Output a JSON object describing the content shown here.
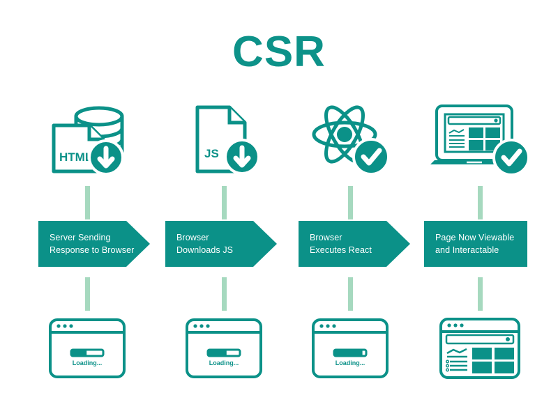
{
  "page": {
    "title": "CSR",
    "background_color": "#ffffff",
    "accent_color": "#0b9188",
    "dash_color": "#a6d9bf",
    "banner_text_color": "#ffffff"
  },
  "steps": [
    {
      "id": "step-1",
      "icon_name": "html-document-database-download-icon",
      "icon_label": "HTML",
      "banner_label": "Server Sending\nResponse to Browser",
      "banner_shape": "arrow",
      "browser_name": "browser-loading-window",
      "browser_status": "Loading...",
      "progress_percent": 45
    },
    {
      "id": "step-2",
      "icon_name": "js-document-download-icon",
      "icon_label": "JS",
      "banner_label": "Browser\nDownloads JS",
      "banner_shape": "arrow",
      "browser_name": "browser-loading-window",
      "browser_status": "Loading...",
      "progress_percent": 55
    },
    {
      "id": "step-3",
      "icon_name": "react-atom-check-icon",
      "icon_label": "",
      "banner_label": "Browser\nExecutes React",
      "banner_shape": "arrow",
      "browser_name": "browser-loading-window",
      "browser_status": "Loading...",
      "progress_percent": 85
    },
    {
      "id": "step-4",
      "icon_name": "laptop-rendered-page-check-icon",
      "icon_label": "",
      "banner_label": "Page Now Viewable\nand Interactable",
      "banner_shape": "rectangle",
      "browser_name": "browser-rendered-window",
      "browser_status": "",
      "progress_percent": 100
    }
  ]
}
